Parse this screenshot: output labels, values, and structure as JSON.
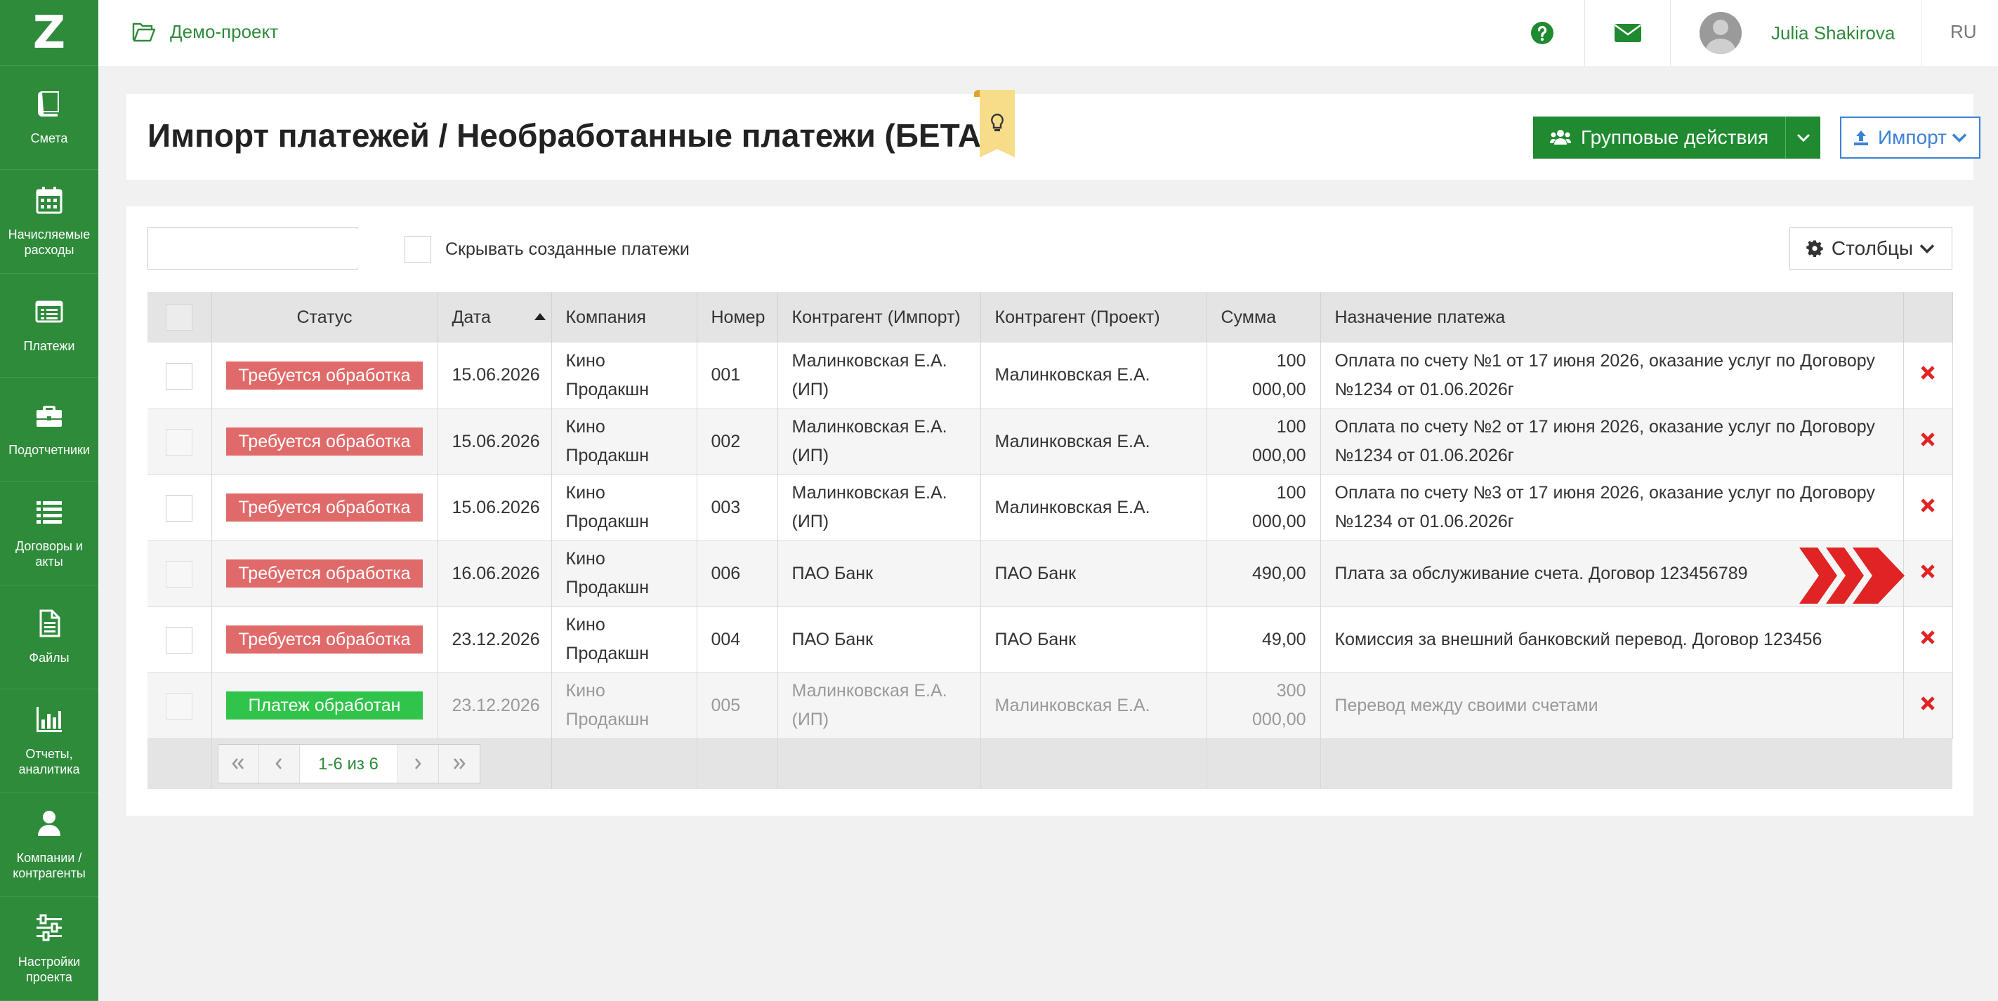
{
  "app": {
    "logo": "Z",
    "project_name": "Демо-проект",
    "user_name": "Julia Shakirova",
    "language": "RU",
    "brand_color": "#2e8b3a"
  },
  "sidebar": {
    "items": [
      {
        "label": "Смета",
        "icon": "book-icon"
      },
      {
        "label": "Начисляемые расходы",
        "icon": "calendar-icon"
      },
      {
        "label": "Платежи",
        "icon": "list-card-icon"
      },
      {
        "label": "Подотчетники",
        "icon": "briefcase-icon"
      },
      {
        "label": "Договоры и акты",
        "icon": "list-icon"
      },
      {
        "label": "Файлы",
        "icon": "file-icon"
      },
      {
        "label": "Отчеты, аналитика",
        "icon": "bar-chart-icon"
      },
      {
        "label": "Компании / контрагенты",
        "icon": "user-icon"
      },
      {
        "label": "Настройки проекта",
        "icon": "sliders-icon"
      }
    ]
  },
  "header": {
    "title": "Импорт платежей / Необработанные платежи (БЕТА)",
    "group_actions_label": "Групповые действия",
    "import_label": "Импорт"
  },
  "toolbar": {
    "search_placeholder": "",
    "hide_created_label": "Скрывать созданные платежи",
    "columns_label": "Столбцы"
  },
  "table": {
    "columns": [
      "Статус",
      "Дата",
      "Компания",
      "Номер",
      "Контрагент (Импорт)",
      "Контрагент (Проект)",
      "Сумма",
      "Назначение платежа"
    ],
    "rows": [
      {
        "status": "Требуется обработка",
        "status_type": "pending",
        "date": "15.06.2026",
        "company": "Кино Продакшн",
        "number": "001",
        "counterparty_import": "Малинковская Е.А. (ИП)",
        "counterparty_project": "Малинковская Е.А.",
        "amount": "100 000,00",
        "purpose": "Оплата по счету №1 от 17 июня 2026, оказание услуг по Договору №1234 от 01.06.2026г"
      },
      {
        "status": "Требуется обработка",
        "status_type": "pending",
        "date": "15.06.2026",
        "company": "Кино Продакшн",
        "number": "002",
        "counterparty_import": "Малинковская Е.А. (ИП)",
        "counterparty_project": "Малинковская Е.А.",
        "amount": "100 000,00",
        "purpose": "Оплата по счету №2 от 17 июня 2026, оказание услуг по Договору №1234 от 01.06.2026г"
      },
      {
        "status": "Требуется обработка",
        "status_type": "pending",
        "date": "15.06.2026",
        "company": "Кино Продакшн",
        "number": "003",
        "counterparty_import": "Малинковская Е.А. (ИП)",
        "counterparty_project": "Малинковская Е.А.",
        "amount": "100 000,00",
        "purpose": "Оплата по счету №3 от 17 июня 2026, оказание услуг по Договору №1234 от 01.06.2026г"
      },
      {
        "status": "Требуется обработка",
        "status_type": "pending",
        "date": "16.06.2026",
        "company": "Кино Продакшн",
        "number": "006",
        "counterparty_import": "ПАО Банк",
        "counterparty_project": "ПАО Банк",
        "amount": "490,00",
        "purpose": "Плата за обслуживание счета. Договор 123456789"
      },
      {
        "status": "Требуется обработка",
        "status_type": "pending",
        "date": "23.12.2026",
        "company": "Кино Продакшн",
        "number": "004",
        "counterparty_import": "ПАО Банк",
        "counterparty_project": "ПАО Банк",
        "amount": "49,00",
        "purpose": "Комиссия за внешний банковский перевод. Договор 123456"
      },
      {
        "status": "Платеж обработан",
        "status_type": "done",
        "date": "23.12.2026",
        "company": "Кино Продакшн",
        "number": "005",
        "counterparty_import": "Малинковская Е.А. (ИП)",
        "counterparty_project": "Малинковская Е.А.",
        "amount": "300 000,00",
        "purpose": "Перевод между своими счетами"
      }
    ],
    "pager_info": "1-6 из 6"
  },
  "colors": {
    "pending_badge": "#e06a6a",
    "done_badge": "#30c44a",
    "delete_icon": "#e02424",
    "highlight_arrows": "#e02424",
    "import_button": "#3c82d4"
  }
}
